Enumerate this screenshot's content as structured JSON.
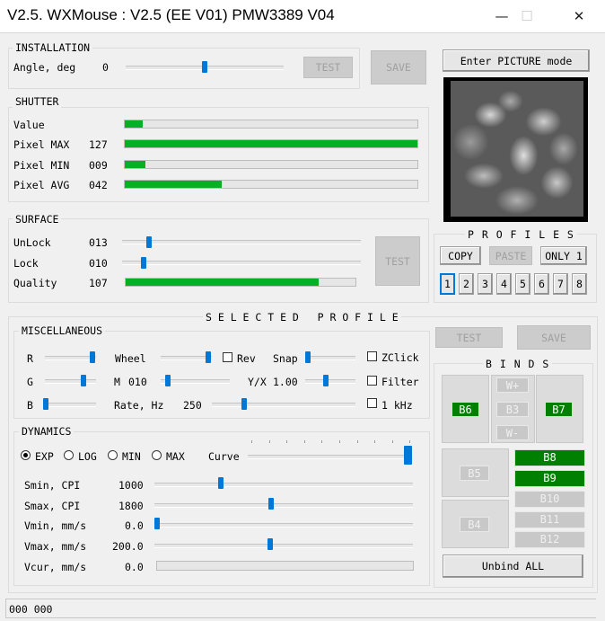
{
  "window": {
    "title": "V2.5. WXMouse : V2.5 (EE V01) PMW3389 V04",
    "minimize": "—",
    "maximize": "☐",
    "close": "✕"
  },
  "installation": {
    "group": "INSTALLATION",
    "angle_label": "Angle, deg",
    "angle_value": "0",
    "test": "TEST",
    "save": "SAVE"
  },
  "picture": {
    "button": "Enter PICTURE mode"
  },
  "shutter": {
    "group": "SHUTTER",
    "rows": [
      {
        "label": "Value",
        "value": "",
        "fill": 0.06
      },
      {
        "label": "Pixel MAX",
        "value": "127",
        "fill": 1.0
      },
      {
        "label": "Pixel MIN",
        "value": "009",
        "fill": 0.07
      },
      {
        "label": "Pixel AVG",
        "value": "042",
        "fill": 0.33
      }
    ]
  },
  "surface": {
    "group": "SURFACE",
    "unlock_label": "UnLock",
    "unlock_value": "013",
    "lock_label": "Lock",
    "lock_value": "010",
    "quality_label": "Quality",
    "quality_value": "107",
    "quality_fill": 0.84,
    "test": "TEST"
  },
  "profiles": {
    "group": "P R O F I L E S",
    "copy": "COPY",
    "paste": "PASTE",
    "only1": "ONLY 1",
    "numbers": [
      "1",
      "2",
      "3",
      "4",
      "5",
      "6",
      "7",
      "8"
    ],
    "selected": "1"
  },
  "selected_profile": {
    "title": "S E L E C T E D   P R O F I L E",
    "test": "TEST",
    "save": "SAVE"
  },
  "misc": {
    "group": "MISCELLANEOUS",
    "r": "R",
    "g": "G",
    "b": "B",
    "wheel": "Wheel",
    "rev": "Rev",
    "snap": "Snap",
    "m_label": "M",
    "m_value": "010",
    "yx_label": "Y/X",
    "yx_value": "1.00",
    "rate_label": "Rate, Hz",
    "rate_value": "250",
    "zclick": "ZClick",
    "filter": "Filter",
    "khz": "1 kHz"
  },
  "dynamics": {
    "group": "DYNAMICS",
    "modes": [
      "EXP",
      "LOG",
      "MIN",
      "MAX"
    ],
    "selected_mode": "EXP",
    "curve": "Curve",
    "smin_label": "Smin, CPI",
    "smin_value": "1000",
    "smax_label": "Smax, CPI",
    "smax_value": "1800",
    "vmin_label": "Vmin, mm/s",
    "vmin_value": "0.0",
    "vmax_label": "Vmax, mm/s",
    "vmax_value": "200.0",
    "vcur_label": "Vcur, mm/s",
    "vcur_value": "0.0"
  },
  "binds": {
    "group": "B I N D S",
    "b6": "B6",
    "w_up": "W+",
    "b3": "B3",
    "w_down": "W-",
    "b7": "B7",
    "b5": "B5",
    "b8": "B8",
    "b9": "B9",
    "b10": "B10",
    "b4": "B4",
    "b11": "B11",
    "b12": "B12",
    "unbind": "Unbind ALL"
  },
  "status": {
    "text": "000 000"
  },
  "colors": {
    "accent": "#0078d7",
    "progress": "#06b025",
    "bind_active": "#008000"
  }
}
